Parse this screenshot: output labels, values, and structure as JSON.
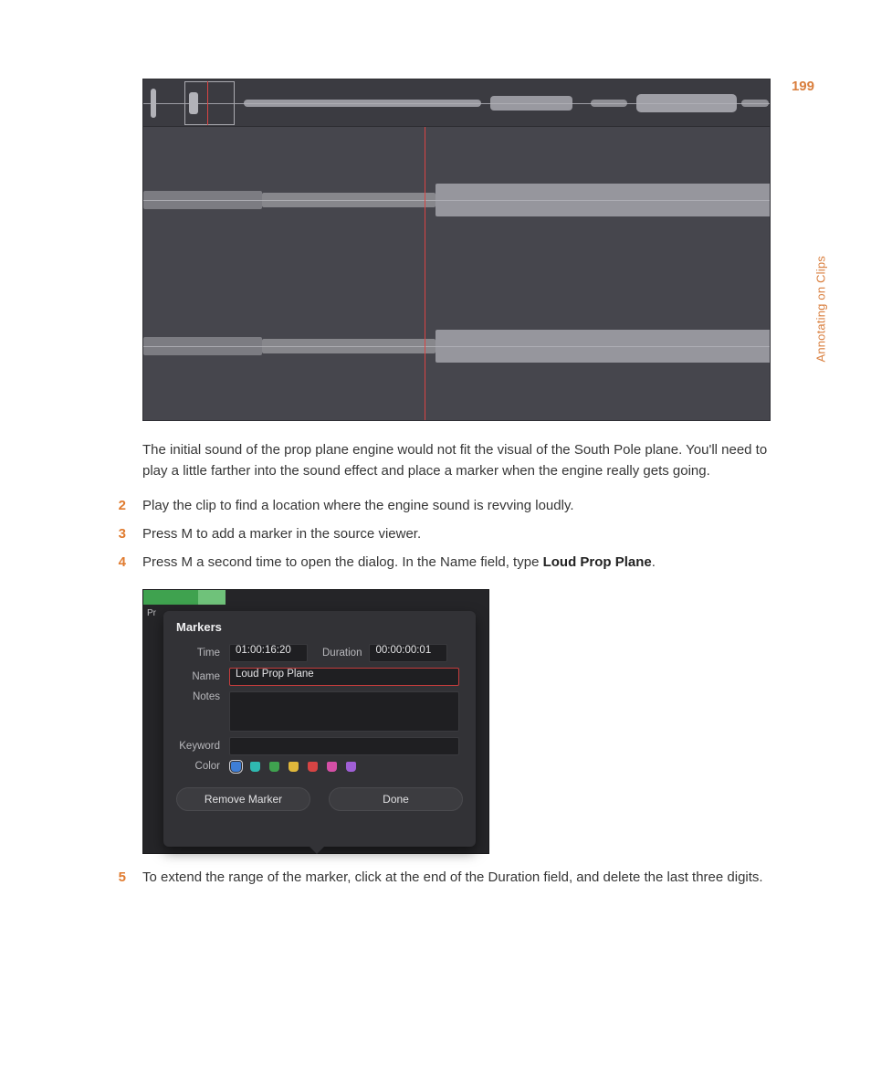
{
  "page_number": "199",
  "side_label": "Annotating on Clips",
  "intro_para": "The initial sound of the prop plane engine would not fit the visual of the South Pole plane. You'll need to play a little farther into the sound effect and place a marker when the engine really gets going.",
  "steps": [
    {
      "num": "2",
      "text": "Play the clip to find a location where the engine sound is revving loudly."
    },
    {
      "num": "3",
      "text": "Press M to add a marker in the source viewer."
    },
    {
      "num": "4",
      "text_prefix": "Press M a second time to open the dialog. In the Name field, type ",
      "text_bold": "Loud Prop Plane",
      "text_suffix": "."
    },
    {
      "num": "5",
      "text": "To extend the range of the marker, click at the end of the Duration field, and delete the last three digits."
    }
  ],
  "dialog": {
    "title": "Markers",
    "time_label": "Time",
    "time_value": "01:00:16:20",
    "duration_label": "Duration",
    "duration_value": "00:00:00:01",
    "name_label": "Name",
    "name_value": "Loud Prop Plane",
    "notes_label": "Notes",
    "keyword_label": "Keyword",
    "color_label": "Color",
    "colors": [
      "#3e7ed6",
      "#2fb9b1",
      "#3fa24f",
      "#e0b83b",
      "#d64444",
      "#d54fa6",
      "#a05fd6"
    ],
    "remove_btn": "Remove Marker",
    "done_btn": "Done",
    "pr_tab": "Pr"
  }
}
